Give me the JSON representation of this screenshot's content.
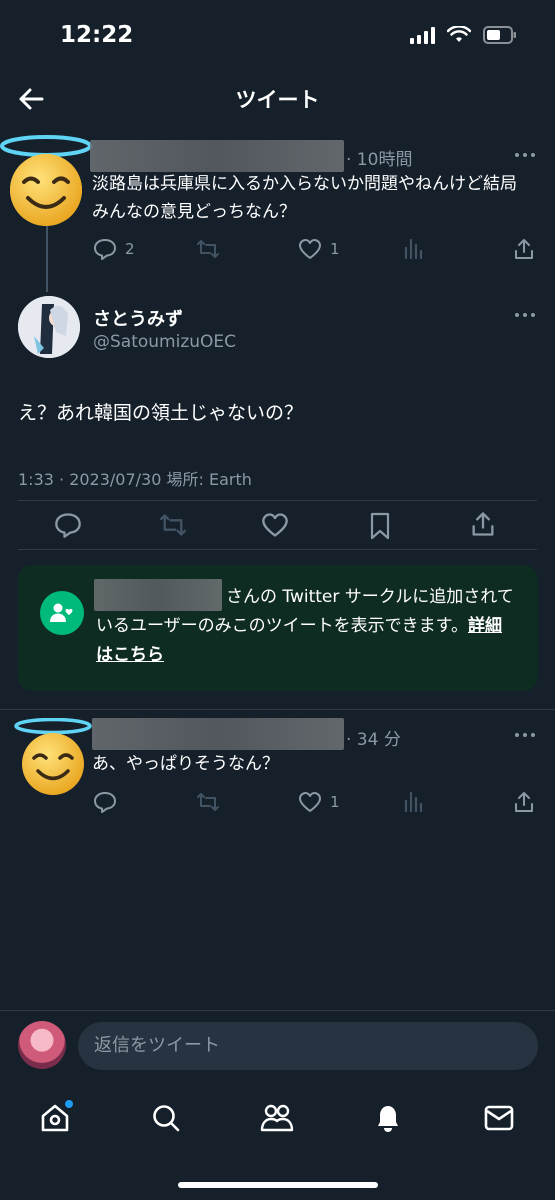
{
  "status_bar": {
    "time": "12:22"
  },
  "header": {
    "title": "ツイート"
  },
  "parent_tweet": {
    "time": "· 10時間",
    "text": "淡路島は兵庫県に入るか入らないか問題やねんけど結局みんなの意見どっちなん？",
    "reply_count": "2",
    "like_count": "1"
  },
  "main_tweet": {
    "name": "さとうみず",
    "handle": "@SatoumizuOEC",
    "text": "え？あれ韓国の領土じゃないの？",
    "meta": "1:33 · 2023/07/30 場所: Earth"
  },
  "circle_notice": {
    "text": "さんの Twitter サークルに追加されているユーザーのみこのツイートを表示できます。",
    "link": "詳細はこちら"
  },
  "reply_tweet": {
    "time": "· 34 分",
    "text": "あ、やっぱりそうなん？",
    "like_count": "1"
  },
  "reply_bar": {
    "placeholder": "返信をツイート"
  },
  "colors": {
    "background": "#15202b",
    "accent": "#1d9bf0",
    "circle_green": "#00ba7c",
    "muted": "#8b98a5"
  },
  "icons": [
    "back-arrow-icon",
    "more-icon",
    "reply-icon",
    "retweet-icon",
    "like-icon",
    "views-icon",
    "bookmark-icon",
    "share-icon",
    "circle-people-icon",
    "home-icon",
    "search-icon",
    "communities-icon",
    "notifications-icon",
    "messages-icon"
  ]
}
